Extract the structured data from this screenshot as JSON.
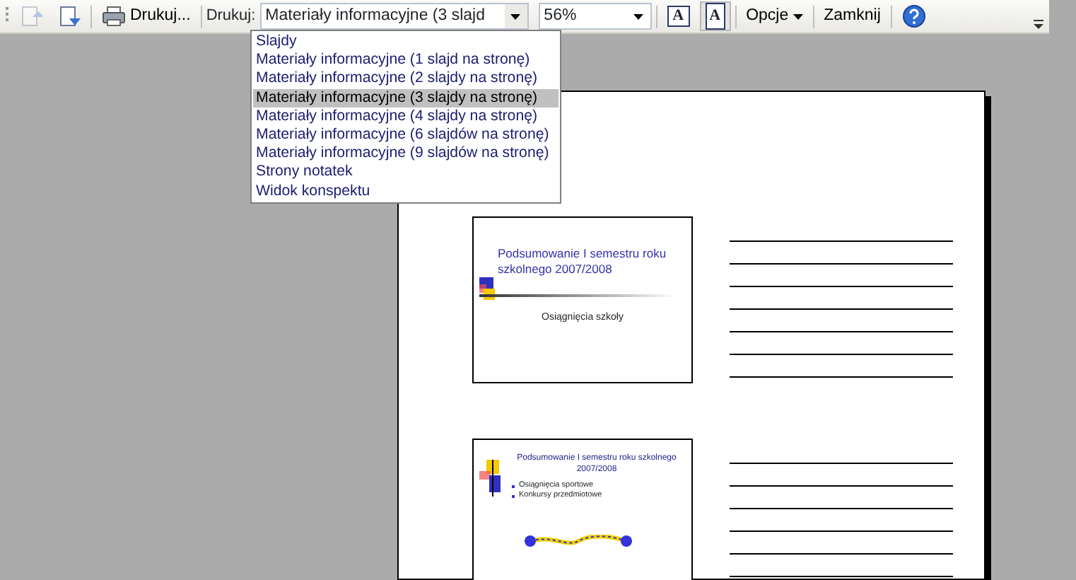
{
  "toolbar": {
    "page_buttons": [
      {
        "disabled": true
      },
      {
        "disabled": false
      }
    ],
    "print_button": "Drukuj...",
    "print_what_label": "Drukuj:",
    "print_what_value": "Materiały informacyjne (3 slajd",
    "zoom_value": "56%",
    "view_toggles": [
      {
        "label": "A",
        "selected": false
      },
      {
        "label": "A",
        "selected": true
      }
    ],
    "options_button": "Opcje",
    "close_button": "Zamknij"
  },
  "dropdown": {
    "items": [
      {
        "label": "Slajdy",
        "selected": false
      },
      {
        "label": "Materiały informacyjne (1 slajd na stronę)",
        "selected": false
      },
      {
        "label": "Materiały informacyjne (2 slajdy na stronę)",
        "selected": false
      },
      {
        "label": "Materiały informacyjne (3 slajdy na stronę)",
        "selected": true
      },
      {
        "label": "Materiały informacyjne (4 slajdy na stronę)",
        "selected": false
      },
      {
        "label": "Materiały informacyjne (6 slajdów na stronę)",
        "selected": false
      },
      {
        "label": "Materiały informacyjne (9 slajdów na stronę)",
        "selected": false
      },
      {
        "label": "Strony notatek",
        "selected": false
      },
      {
        "label": "Widok konspektu",
        "selected": false
      }
    ]
  },
  "preview": {
    "slides": [
      {
        "kind": "title",
        "title": "Podsumowanie I semestru roku szkolnego 2007/2008",
        "subtitle": "Osiągnięcia szkoły"
      },
      {
        "kind": "bullets",
        "title": "Podsumowanie I semestru roku szkolnego 2007/2008",
        "bullets": [
          "Osiągnięcia sportowe",
          "Konkursy przedmiotowe"
        ]
      }
    ]
  }
}
